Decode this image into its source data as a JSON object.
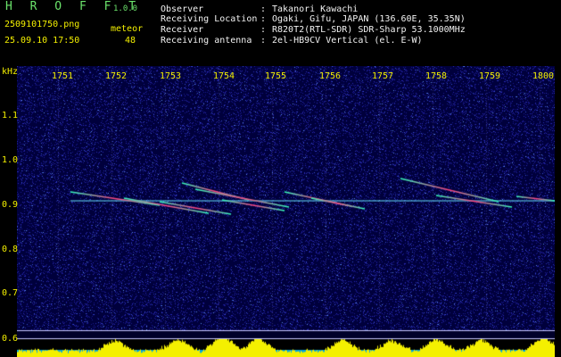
{
  "app": {
    "title": "H R O F F T",
    "version": "1.0.0"
  },
  "file": {
    "name": "2509101750.png",
    "datetime": "25.09.10 17:50"
  },
  "meteor": {
    "label": "meteor",
    "count": "48"
  },
  "info": [
    {
      "key": "Observer",
      "sep": ":",
      "value": "Takanori Kawachi"
    },
    {
      "key": "Receiving Location",
      "sep": ":",
      "value": "Ogaki, Gifu, JAPAN (136.60E, 35.35N)"
    },
    {
      "key": "Receiver",
      "sep": ":",
      "value": "R820T2(RTL-SDR) SDR-Sharp 53.1000MHz"
    },
    {
      "key": "Receiving antenna",
      "sep": ":",
      "value": "2el-HB9CV Vertical (el. E-W)"
    }
  ],
  "axis": {
    "unit": "kHz",
    "time_ticks": [
      "1751",
      "1752",
      "1753",
      "1754",
      "1755",
      "1756",
      "1757",
      "1758",
      "1759",
      "1800"
    ],
    "freq_ticks": [
      "1.1",
      "1.0",
      "0.9",
      "0.8",
      "0.7",
      "0.6"
    ]
  },
  "colors": {
    "background": "#000000",
    "panel": "#000050",
    "signal": "#00e0e0",
    "label": "#f4f000",
    "title": "#6be36b",
    "text": "#f2f2f2"
  }
}
